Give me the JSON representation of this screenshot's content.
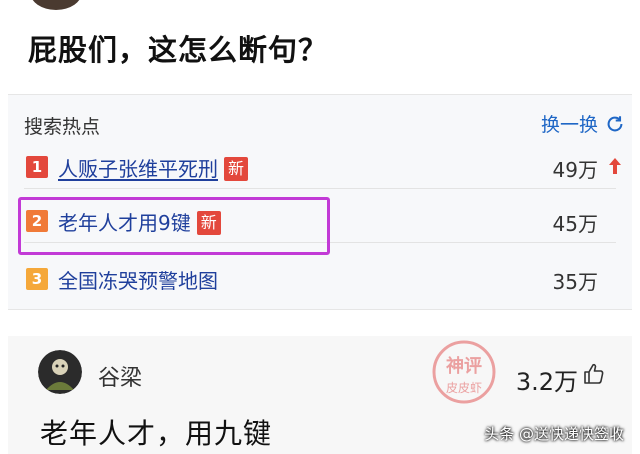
{
  "question": "屁股们，这怎么断句？",
  "hot_search": {
    "title": "搜索热点",
    "refresh_label": "换一换",
    "items": [
      {
        "rank": "1",
        "title": "人贩子张维平死刑",
        "badge": "新",
        "count": "49万",
        "trend": "up",
        "rank_color": "#e3483c"
      },
      {
        "rank": "2",
        "title": "老年人才用9键",
        "badge": "新",
        "count": "45万",
        "rank_color": "#f07a38"
      },
      {
        "rank": "3",
        "title": "全国冻哭预警地图",
        "count": "35万",
        "rank_color": "#f5a83a"
      }
    ],
    "highlight_color": "#c23ad6"
  },
  "comment": {
    "username": "谷梁",
    "likes": "3.2万",
    "text": "老年人才，用九键"
  },
  "stamp": {
    "line1": "神评",
    "line2": "皮皮虾"
  },
  "watermark": "头条 @送快递快签收"
}
